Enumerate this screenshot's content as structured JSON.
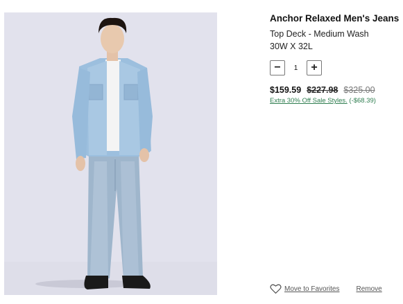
{
  "product": {
    "name": "Anchor Relaxed Men's Jeans",
    "variant": "Top Deck - Medium Wash",
    "size": "30W X 32L",
    "image_icon": "product-photo-model-in-jeans"
  },
  "quantity": {
    "decrement_label": "−",
    "value": "1",
    "increment_label": "+"
  },
  "pricing": {
    "current": "$159.59",
    "was": "$227.98",
    "original": "$325.00",
    "promo_text": "Extra 30% Off Sale Styles.",
    "promo_savings": "(-$68.39)",
    "promo_color": "#2e7d4f"
  },
  "actions": {
    "favorites_label": "Move to Favorites",
    "remove_label": "Remove",
    "favorites_icon": "heart-icon"
  }
}
